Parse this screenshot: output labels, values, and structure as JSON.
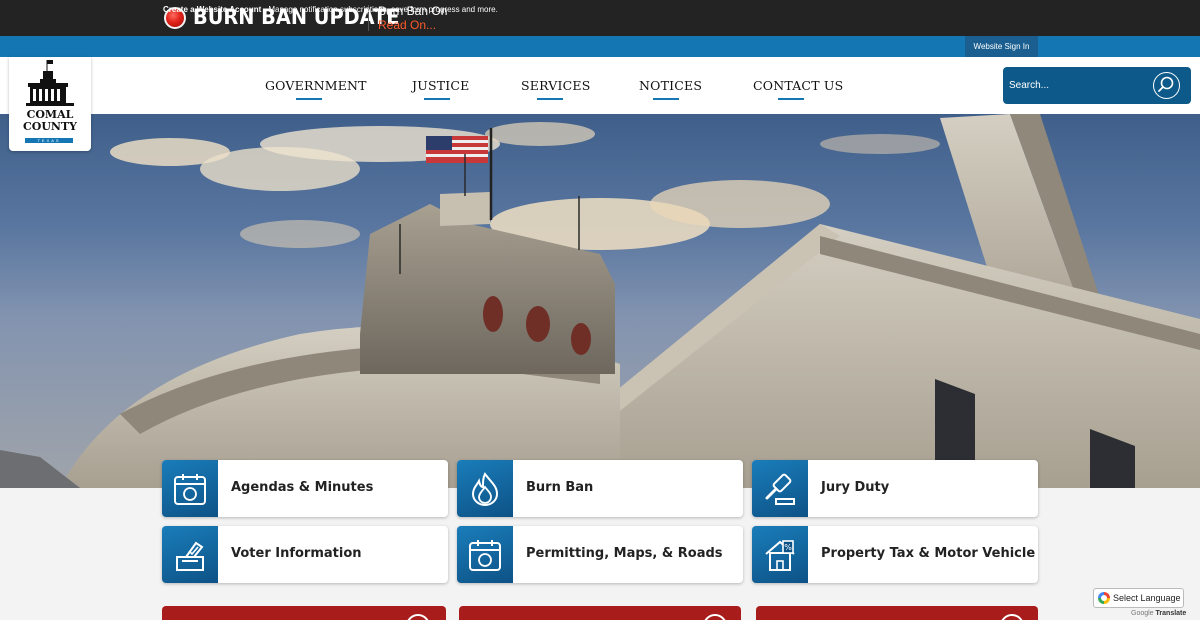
{
  "alert": {
    "title": "BURN BAN UPDATE",
    "message": "Burn Ban On",
    "link": "Read On..."
  },
  "account_bar": {
    "create_link": "Create a Website Account",
    "description": " - Manage notification subscriptions, save form progress and more.",
    "sign_in": "Website Sign In"
  },
  "logo": {
    "line1": "COMAL",
    "line2": "COUNTY",
    "line3": "TEXAS"
  },
  "nav": {
    "items": [
      "GOVERNMENT",
      "JUSTICE",
      "SERVICES",
      "NOTICES",
      "CONTACT US"
    ]
  },
  "search": {
    "placeholder": "Search..."
  },
  "quick_links": [
    {
      "label": "Agendas & Minutes",
      "icon": "calendar-icon"
    },
    {
      "label": "Burn Ban",
      "icon": "flame-icon"
    },
    {
      "label": "Jury Duty",
      "icon": "gavel-icon"
    },
    {
      "label": "Voter Information",
      "icon": "ballot-icon"
    },
    {
      "label": "Permitting, Maps, & Roads",
      "icon": "calendar-icon"
    },
    {
      "label": "Property Tax & Motor Vehicle",
      "icon": "house-tax-icon"
    }
  ],
  "translate": {
    "label": "Select Language",
    "powered_prefix": "Google",
    "powered_suffix": "Translate"
  },
  "colors": {
    "alert_bg": "#232323",
    "accent_blue": "#1476b3",
    "search_bg": "#0d5a8a",
    "card_red": "#a81c1c",
    "link_orange": "#ff5a2a"
  }
}
